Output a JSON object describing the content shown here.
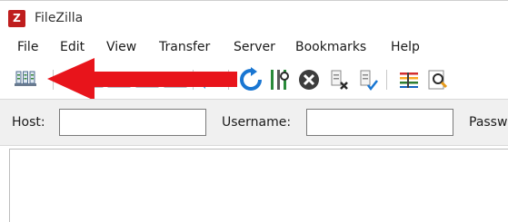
{
  "window": {
    "title": "FileZilla",
    "app_icon_letter": "Z"
  },
  "menu": {
    "items": [
      {
        "label": "File"
      },
      {
        "label": "Edit"
      },
      {
        "label": "View"
      },
      {
        "label": "Transfer"
      },
      {
        "label": "Server"
      },
      {
        "label": "Bookmarks"
      },
      {
        "label": "Help"
      }
    ]
  },
  "toolbar": {
    "buttons": [
      {
        "name": "site-manager",
        "icon": "site-manager-icon"
      },
      {
        "name": "toggle-message-log",
        "icon": "message-log-icon"
      },
      {
        "name": "toggle-local-tree",
        "icon": "local-tree-icon"
      },
      {
        "name": "toggle-remote-tree",
        "icon": "remote-tree-icon"
      },
      {
        "name": "toggle-transfer-queue",
        "icon": "transfer-queue-icon"
      },
      {
        "name": "refresh",
        "icon": "refresh-icon"
      },
      {
        "name": "process-queue",
        "icon": "process-queue-icon"
      },
      {
        "name": "cancel-operation",
        "icon": "cancel-icon"
      },
      {
        "name": "disconnect",
        "icon": "disconnect-icon"
      },
      {
        "name": "reconnect",
        "icon": "reconnect-icon"
      },
      {
        "name": "directory-filters",
        "icon": "filter-icon"
      },
      {
        "name": "search-remote",
        "icon": "search-icon"
      }
    ]
  },
  "annotation": {
    "arrow_color": "#e8141b",
    "points_to": "site-manager-icon"
  },
  "quickconnect": {
    "host_label": "Host:",
    "host_value": "",
    "username_label": "Username:",
    "username_value": "",
    "password_label": "Passw"
  },
  "colors": {
    "app_icon": "#bf1e1e",
    "arrow": "#e8141b",
    "refresh": "#1976d2",
    "process_queue": "#2a8a3a"
  }
}
